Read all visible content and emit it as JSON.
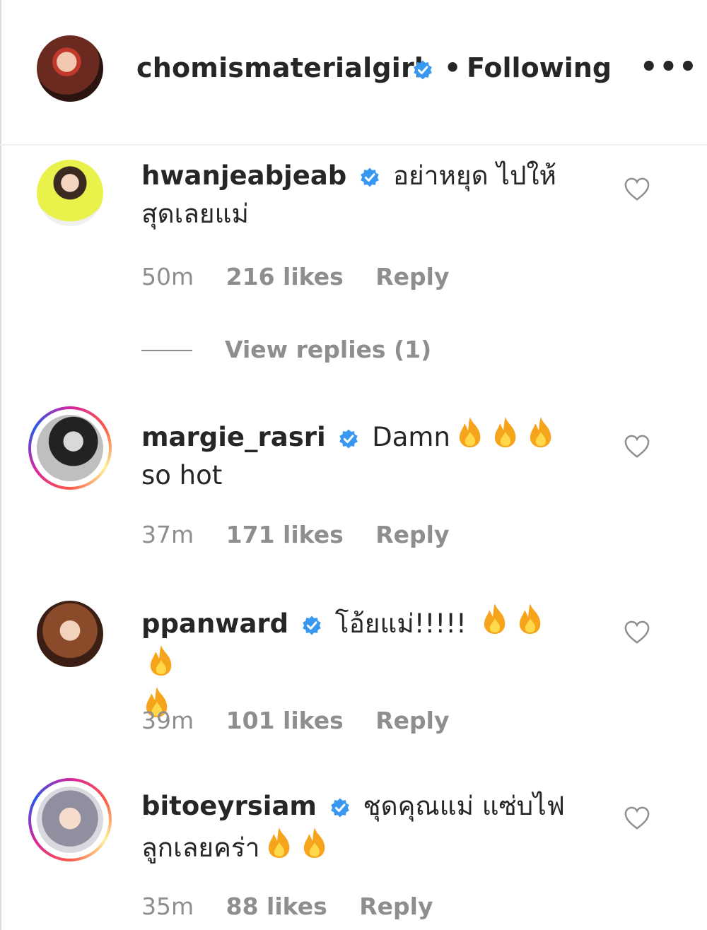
{
  "header": {
    "username": "chomismaterialgirl",
    "separator": "•",
    "follow_status": "Following",
    "more_label": "•••"
  },
  "comments": [
    {
      "username": "hwanjeabjeab",
      "text": "อย่าหยุด ไปให้สุดเลยแม่",
      "time": "50m",
      "likes": "216 likes",
      "reply": "Reply",
      "view_replies": "View replies (1)",
      "story_ring": false
    },
    {
      "username": "margie_rasri",
      "text": "Damn",
      "text_after": "so hot",
      "fire_count": 3,
      "time": "37m",
      "likes": "171 likes",
      "reply": "Reply",
      "story_ring": true
    },
    {
      "username": "ppanward",
      "text": "โอ้ยแม่!!!!!",
      "fire_count": 4,
      "time": "39m",
      "likes": "101 likes",
      "reply": "Reply",
      "story_ring": false
    },
    {
      "username": "bitoeyrsiam",
      "text": "ชุดคุณแม่ แซ่บไฟลูกเลยคร่า",
      "fire_count": 2,
      "time": "35m",
      "likes": "88 likes",
      "reply": "Reply",
      "story_ring": true
    }
  ],
  "colors": {
    "verified": "#3897f0",
    "muted": "#8e8e8e",
    "text": "#262626"
  },
  "icons": {
    "verified": "verified-badge-icon",
    "like": "heart-outline-icon",
    "fire": "fire-emoji-icon",
    "more": "more-options-icon"
  }
}
